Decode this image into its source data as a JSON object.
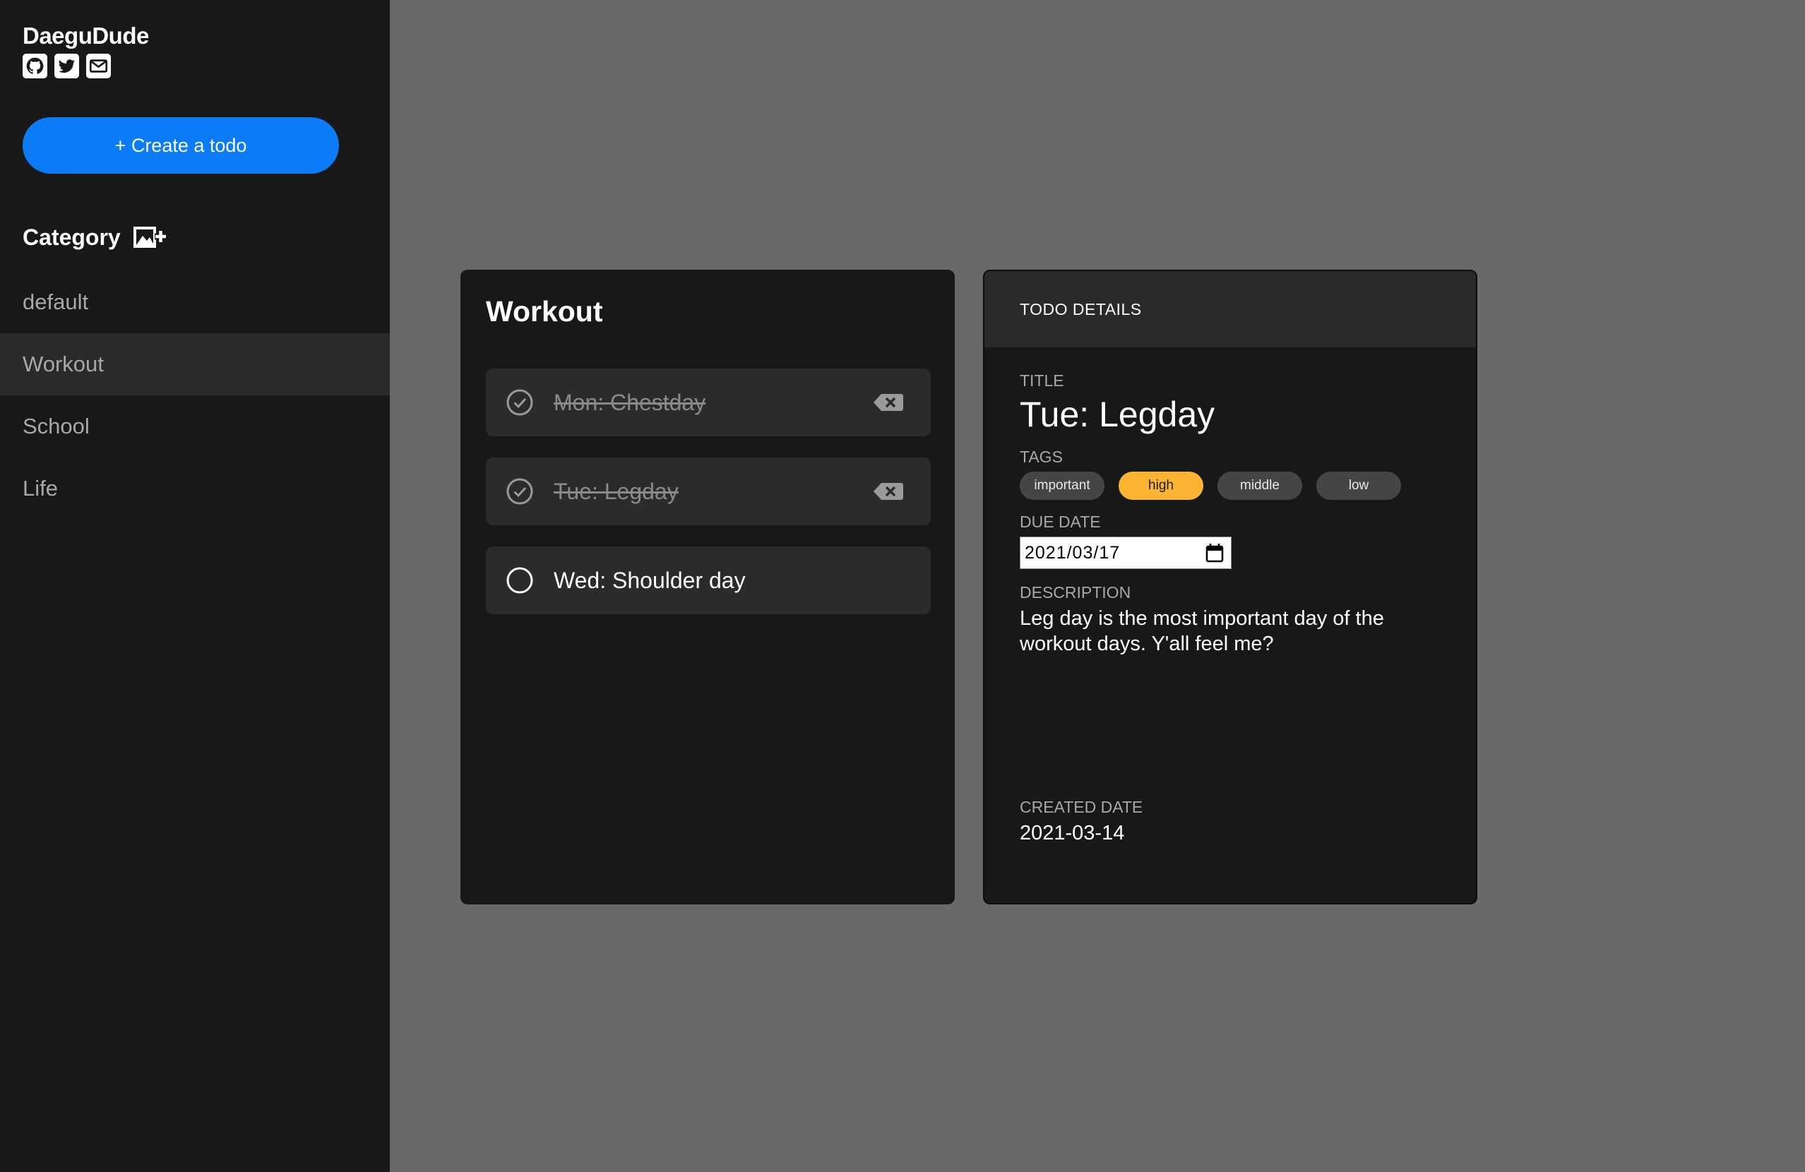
{
  "sidebar": {
    "brand": "DaeguDude",
    "social_icons": [
      "github-icon",
      "twitter-icon",
      "mail-icon"
    ],
    "create_button": "+ Create a todo",
    "category_label": "Category",
    "categories": [
      {
        "label": "default"
      },
      {
        "label": "Workout",
        "active": true
      },
      {
        "label": "School"
      },
      {
        "label": "Life"
      }
    ]
  },
  "todo_list": {
    "title": "Workout",
    "items": [
      {
        "label": "Mon: Chestday",
        "done": true
      },
      {
        "label": "Tue: Legday",
        "done": true
      },
      {
        "label": "Wed: Shoulder day",
        "done": false
      }
    ]
  },
  "details": {
    "header": "TODO DETAILS",
    "title_label": "TITLE",
    "title": "Tue: Legday",
    "tags_label": "TAGS",
    "tags": [
      {
        "label": "important",
        "selected": false
      },
      {
        "label": "high",
        "selected": true
      },
      {
        "label": "middle",
        "selected": false
      },
      {
        "label": "low",
        "selected": false
      }
    ],
    "due_date_label": "DUE DATE",
    "due_date": "2021/03/17",
    "description_label": "DESCRIPTION",
    "description": "Leg day is the most important day of the workout days. Y'all feel me?",
    "created_date_label": "CREATED DATE",
    "created_date": "2021-03-14"
  },
  "colors": {
    "accent": "#0b7bf7",
    "tag_selected": "#fbb431",
    "background": "#696969",
    "panel": "#181818"
  }
}
